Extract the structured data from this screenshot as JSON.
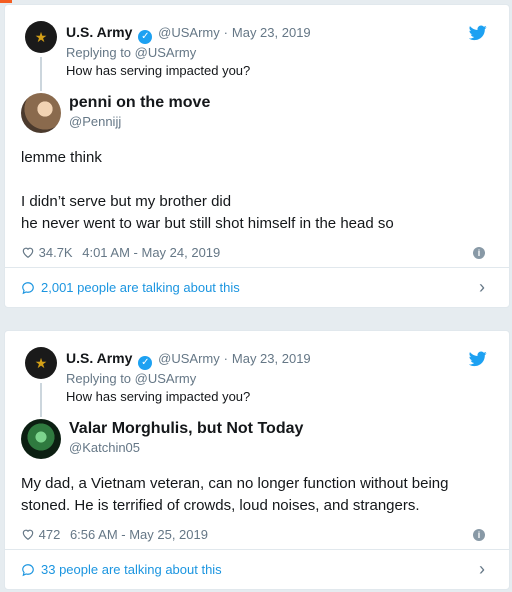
{
  "tweets": [
    {
      "quoted": {
        "name": "U.S. Army",
        "handle": "@USArmy",
        "separator": "·",
        "date": "May 23, 2019",
        "reply_to": "Replying to @USArmy",
        "text": "How has serving impacted you?"
      },
      "author": {
        "name": "penni on the move",
        "handle": "@Pennijj"
      },
      "text_paragraphs": [
        "lemme think",
        "I didn’t serve but my brother did",
        "he never went to war but still shot himself in the head so"
      ],
      "likes": "34.7K",
      "timestamp": "4:01 AM - May 24, 2019",
      "talking": "2,001 people are talking about this"
    },
    {
      "quoted": {
        "name": "U.S. Army",
        "handle": "@USArmy",
        "separator": "·",
        "date": "May 23, 2019",
        "reply_to": "Replying to @USArmy",
        "text": "How has serving impacted you?"
      },
      "author": {
        "name": "Valar Morghulis, but Not Today",
        "handle": "@Katchin05"
      },
      "text_paragraphs": [
        "My dad, a Vietnam veteran, can no longer function without being stoned. He is terrified of crowds, loud noises, and strangers."
      ],
      "likes": "472",
      "timestamp": "6:56 AM - May 25, 2019",
      "talking": "33 people are talking about this"
    }
  ],
  "colors": {
    "link": "#1b95e0",
    "verified": "#1da1f2",
    "muted": "#657786",
    "background": "#e6ecf0"
  }
}
